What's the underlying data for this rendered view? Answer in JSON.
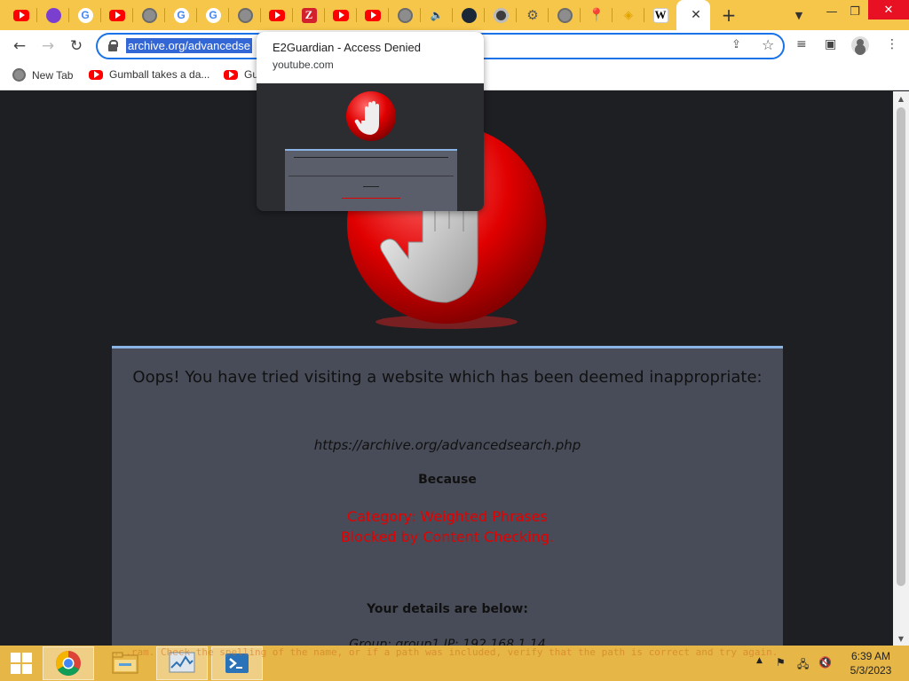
{
  "browser": {
    "url": "archive.org/advancedse",
    "bookmarks": [
      "New Tab",
      "Gumball takes a da...",
      "Gu"
    ],
    "tabs": [
      {
        "icon": "youtube-icon"
      },
      {
        "icon": "purple-icon"
      },
      {
        "icon": "google-icon"
      },
      {
        "icon": "youtube-icon"
      },
      {
        "icon": "globe-icon"
      },
      {
        "icon": "google-icon"
      },
      {
        "icon": "google-icon"
      },
      {
        "icon": "globe-icon"
      },
      {
        "icon": "youtube-icon"
      },
      {
        "icon": "zotero-icon"
      },
      {
        "icon": "youtube-icon"
      },
      {
        "icon": "youtube-icon"
      },
      {
        "icon": "globe-icon"
      },
      {
        "icon": "speaker-icon"
      },
      {
        "icon": "steam-icon"
      },
      {
        "icon": "chrome-icon"
      },
      {
        "icon": "gear-icon"
      },
      {
        "icon": "globe-icon"
      },
      {
        "icon": "maps-icon"
      },
      {
        "icon": "chip-icon"
      },
      {
        "icon": "wikipedia-icon"
      }
    ],
    "new_tab_label": "+",
    "close_tab_label": "✕"
  },
  "preview": {
    "title": "E2Guardian - Access Denied",
    "host": "youtube.com"
  },
  "page": {
    "title": "Oops! You have tried visiting a website which has been deemed inappropriate:",
    "blocked_url": "https://archive.org/advancedsearch.php",
    "because": "Because",
    "reason_category": "Category: Weighted Phrases",
    "reason_detail": "Blocked by Content Checking.",
    "details_heading": "Your details are below:",
    "details_value": "Group: group1   IP: 192.168.1.14"
  },
  "taskbar": {
    "time": "6:39 AM",
    "date": "5/3/2023",
    "error_text": "...ram. Check the spelling of the name, or if a path was included, verify that the path is correct and try again."
  },
  "colors": {
    "tabstrip": "#f6c64a",
    "taskbar": "#e6b646",
    "panel": "#484c58",
    "reason": "#e30000",
    "page_bg": "#1e1f23"
  }
}
